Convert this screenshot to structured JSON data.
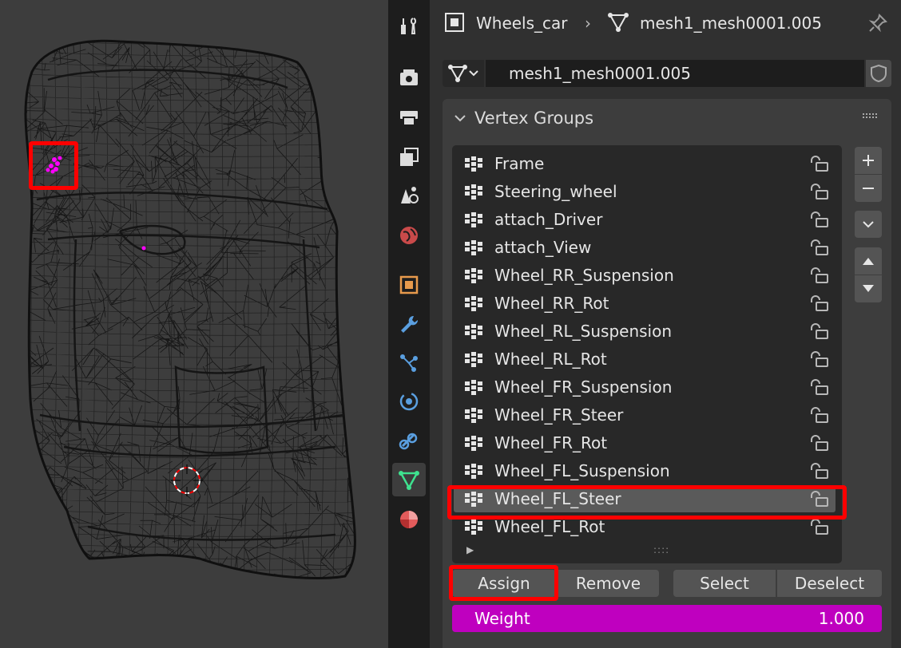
{
  "header": {
    "object_name": "Wheels_car",
    "mesh_name": "mesh1_mesh0001.005",
    "pin_icon": "pin-icon"
  },
  "datablock": {
    "name": "mesh1_mesh0001.005"
  },
  "vertex_groups": {
    "title": "Vertex Groups",
    "items": [
      {
        "label": "Frame",
        "selected": false
      },
      {
        "label": "Steering_wheel",
        "selected": false
      },
      {
        "label": "attach_Driver",
        "selected": false
      },
      {
        "label": "attach_View",
        "selected": false
      },
      {
        "label": "Wheel_RR_Suspension",
        "selected": false
      },
      {
        "label": "Wheel_RR_Rot",
        "selected": false
      },
      {
        "label": "Wheel_RL_Suspension",
        "selected": false
      },
      {
        "label": "Wheel_RL_Rot",
        "selected": false
      },
      {
        "label": "Wheel_FR_Suspension",
        "selected": false
      },
      {
        "label": "Wheel_FR_Steer",
        "selected": false
      },
      {
        "label": "Wheel_FR_Rot",
        "selected": false
      },
      {
        "label": "Wheel_FL_Suspension",
        "selected": false
      },
      {
        "label": "Wheel_FL_Steer",
        "selected": true
      },
      {
        "label": "Wheel_FL_Rot",
        "selected": false
      }
    ],
    "list_grip": "::::",
    "buttons": {
      "assign": "Assign",
      "remove": "Remove",
      "select": "Select",
      "deselect": "Deselect"
    },
    "weight": {
      "label": "Weight",
      "value": "1.000"
    }
  },
  "tabs": [
    "tool",
    "render",
    "output",
    "view-layer",
    "scene",
    "world",
    "object",
    "modifiers",
    "particles",
    "physics",
    "constraints",
    "data",
    "material"
  ],
  "active_tab": "data",
  "colors": {
    "accent": "#bf00bf",
    "highlight": "#ff0000",
    "selected_row": "#5a5a5a"
  }
}
